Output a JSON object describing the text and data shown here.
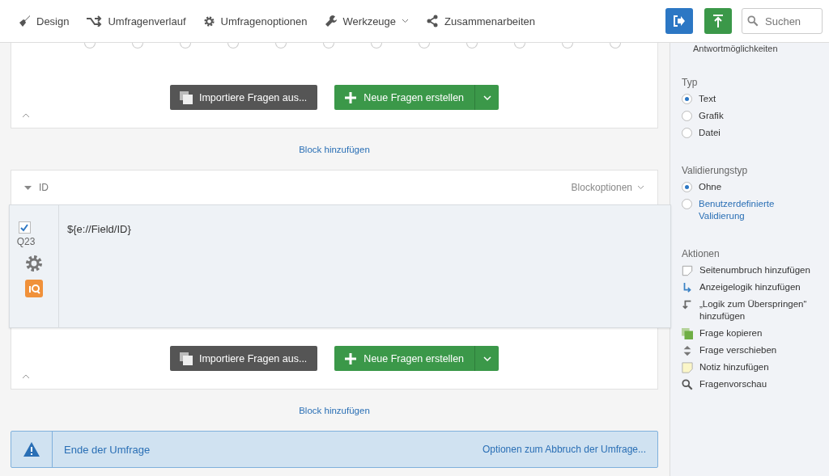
{
  "toolbar": {
    "items": [
      {
        "label": "Design",
        "kind": "brush",
        "dropdown": false
      },
      {
        "label": "Umfragenverlauf",
        "kind": "flow",
        "dropdown": false
      },
      {
        "label": "Umfragenoptionen",
        "kind": "gear",
        "dropdown": false
      },
      {
        "label": "Werkzeuge",
        "kind": "wrench",
        "dropdown": true
      },
      {
        "label": "Zusammenarbeiten",
        "kind": "share",
        "dropdown": false
      }
    ],
    "search": {
      "placeholder": "Suchen"
    }
  },
  "blocks": [
    {
      "choices": [
        {
          "selected": false
        },
        {
          "selected": false
        },
        {
          "selected": false
        },
        {
          "selected": false
        },
        {
          "selected": false
        },
        {
          "selected": false
        },
        {
          "selected": false
        },
        {
          "selected": false
        },
        {
          "selected": false
        },
        {
          "selected": false
        },
        {
          "selected": false
        },
        {
          "selected": false
        }
      ],
      "import_label": "Importiere Fragen aus...",
      "create_label": "Neue Fragen erstellen",
      "add_block": "Block hinzufügen"
    },
    {
      "title": "ID",
      "options": "Blockoptionen",
      "question": {
        "checked": true,
        "number": "Q23",
        "text": "${e://Field/ID}"
      },
      "import_label": "Importiere Fragen aus...",
      "create_label": "Neue Fragen erstellen",
      "add_block": "Block hinzufügen"
    }
  ],
  "end_of_survey": {
    "title": "Ende der Umfrage",
    "options": "Optionen zum Abbruch der Umfrage..."
  },
  "panel": {
    "cut_heading": "Antwortmöglichkeiten",
    "type": {
      "heading": "Typ",
      "options": [
        {
          "label": "Text",
          "selected": true,
          "link": false
        },
        {
          "label": "Grafik",
          "selected": false,
          "link": false
        },
        {
          "label": "Datei",
          "selected": false,
          "link": false
        }
      ]
    },
    "validation": {
      "heading": "Validierungstyp",
      "options": [
        {
          "label": "Ohne",
          "selected": true,
          "link": false
        },
        {
          "label": "Benutzerdefinierte Validierung",
          "selected": false,
          "link": true
        }
      ]
    },
    "actions": {
      "heading": "Aktionen",
      "items": [
        {
          "label": "Seitenumbruch hinzufügen",
          "kind": "page"
        },
        {
          "label": "Anzeigelogik hinzufügen",
          "kind": "display"
        },
        {
          "label": "„Logik zum Überspringen“ hinzufügen",
          "kind": "skip"
        },
        {
          "label": "Frage kopieren",
          "kind": "copy"
        },
        {
          "label": "Frage verschieben",
          "kind": "move"
        },
        {
          "label": "Notiz hinzufügen",
          "kind": "note"
        },
        {
          "label": "Fragenvorschau",
          "kind": "preview"
        }
      ]
    }
  }
}
